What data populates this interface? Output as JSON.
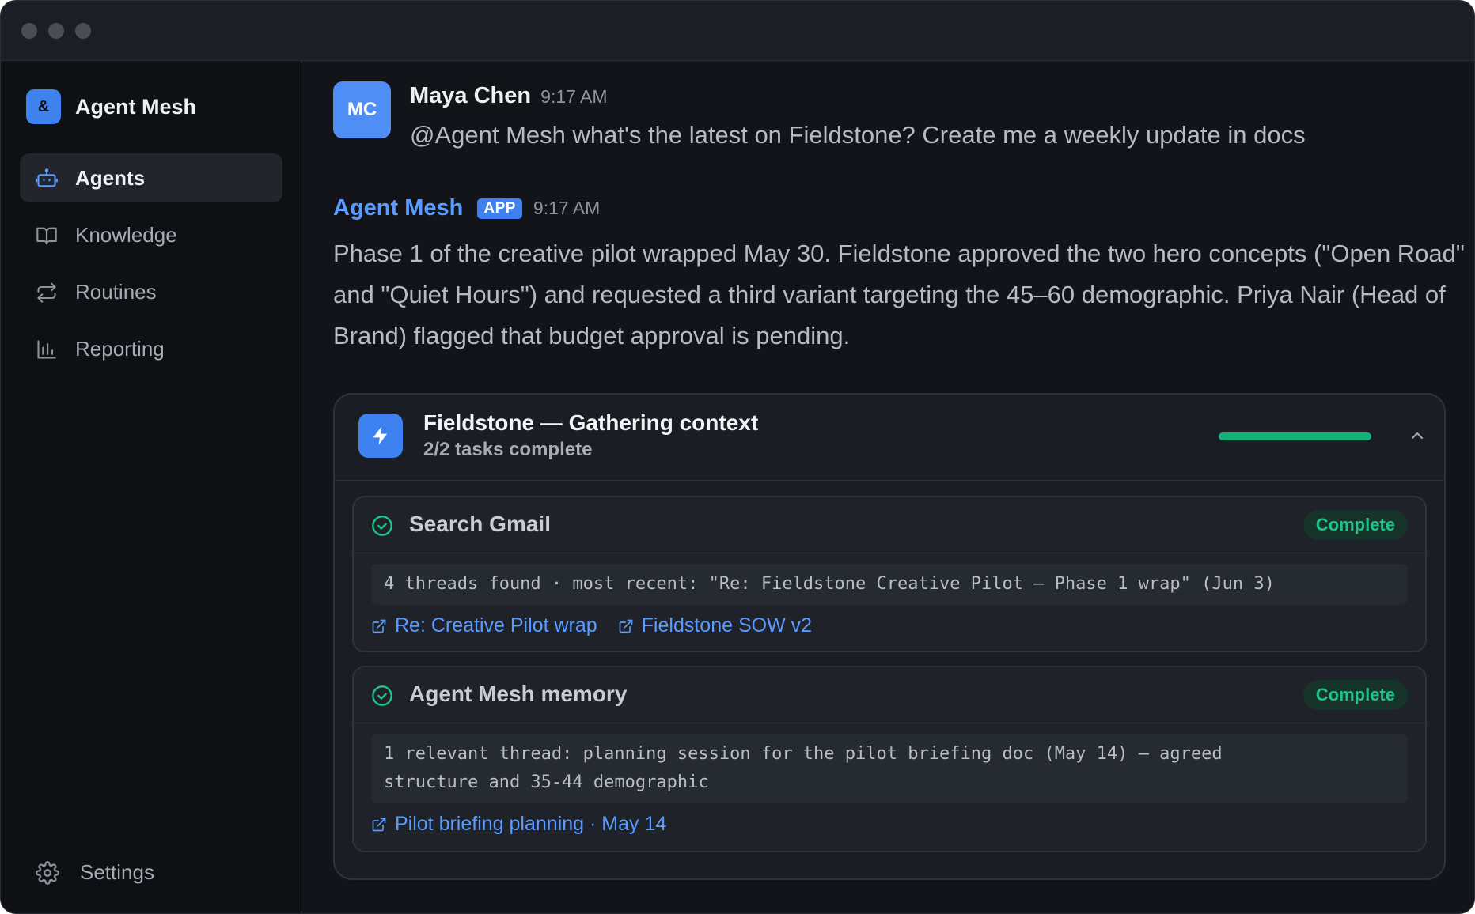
{
  "sidebar": {
    "brand": {
      "logo": "&",
      "name": "Agent Mesh"
    },
    "items": [
      {
        "label": "Agents",
        "icon": "robot-icon",
        "active": true
      },
      {
        "label": "Knowledge",
        "icon": "book-icon",
        "active": false
      },
      {
        "label": "Routines",
        "icon": "repeat-icon",
        "active": false
      },
      {
        "label": "Reporting",
        "icon": "bar-chart-icon",
        "active": false
      }
    ],
    "settings": {
      "label": "Settings",
      "icon": "gear-icon"
    }
  },
  "chat": {
    "user_message": {
      "avatar": "MC",
      "author": "Maya Chen",
      "time": "9:17 AM",
      "text": "@Agent Mesh what's the latest on Fieldstone? Create me a weekly update in docs"
    },
    "bot_message": {
      "author": "Agent Mesh",
      "badge": "APP",
      "time": "9:17 AM",
      "text": "Phase 1 of the creative pilot wrapped May 30. Fieldstone approved the two hero concepts (\"Open Road\" and \"Quiet Hours\") and requested a third variant targeting the 45–60 demographic. Priya Nair (Head of Brand) flagged that budget approval is pending."
    }
  },
  "panel": {
    "icon": "lightning-icon",
    "title": "Fieldstone — Gathering context",
    "subtitle": "2/2 tasks complete",
    "progress": 1.0,
    "tasks": [
      {
        "title": "Search Gmail",
        "status": "Complete",
        "output": "4 threads found · most recent: \"Re: Fieldstone Creative Pilot — Phase 1 wrap\" (Jun 3)",
        "links": [
          "Re: Creative Pilot wrap",
          "Fieldstone SOW v2"
        ]
      },
      {
        "title": "Agent Mesh memory",
        "status": "Complete",
        "output": "1 relevant thread: planning session for the pilot briefing doc (May 14) — agreed\nstructure and 35-44 demographic",
        "links": [
          "Pilot briefing planning · May 14"
        ]
      }
    ]
  },
  "colors": {
    "accent": "#3d82f0",
    "link": "#5a9bff",
    "success": "#13b07a",
    "background": "#12141a"
  }
}
